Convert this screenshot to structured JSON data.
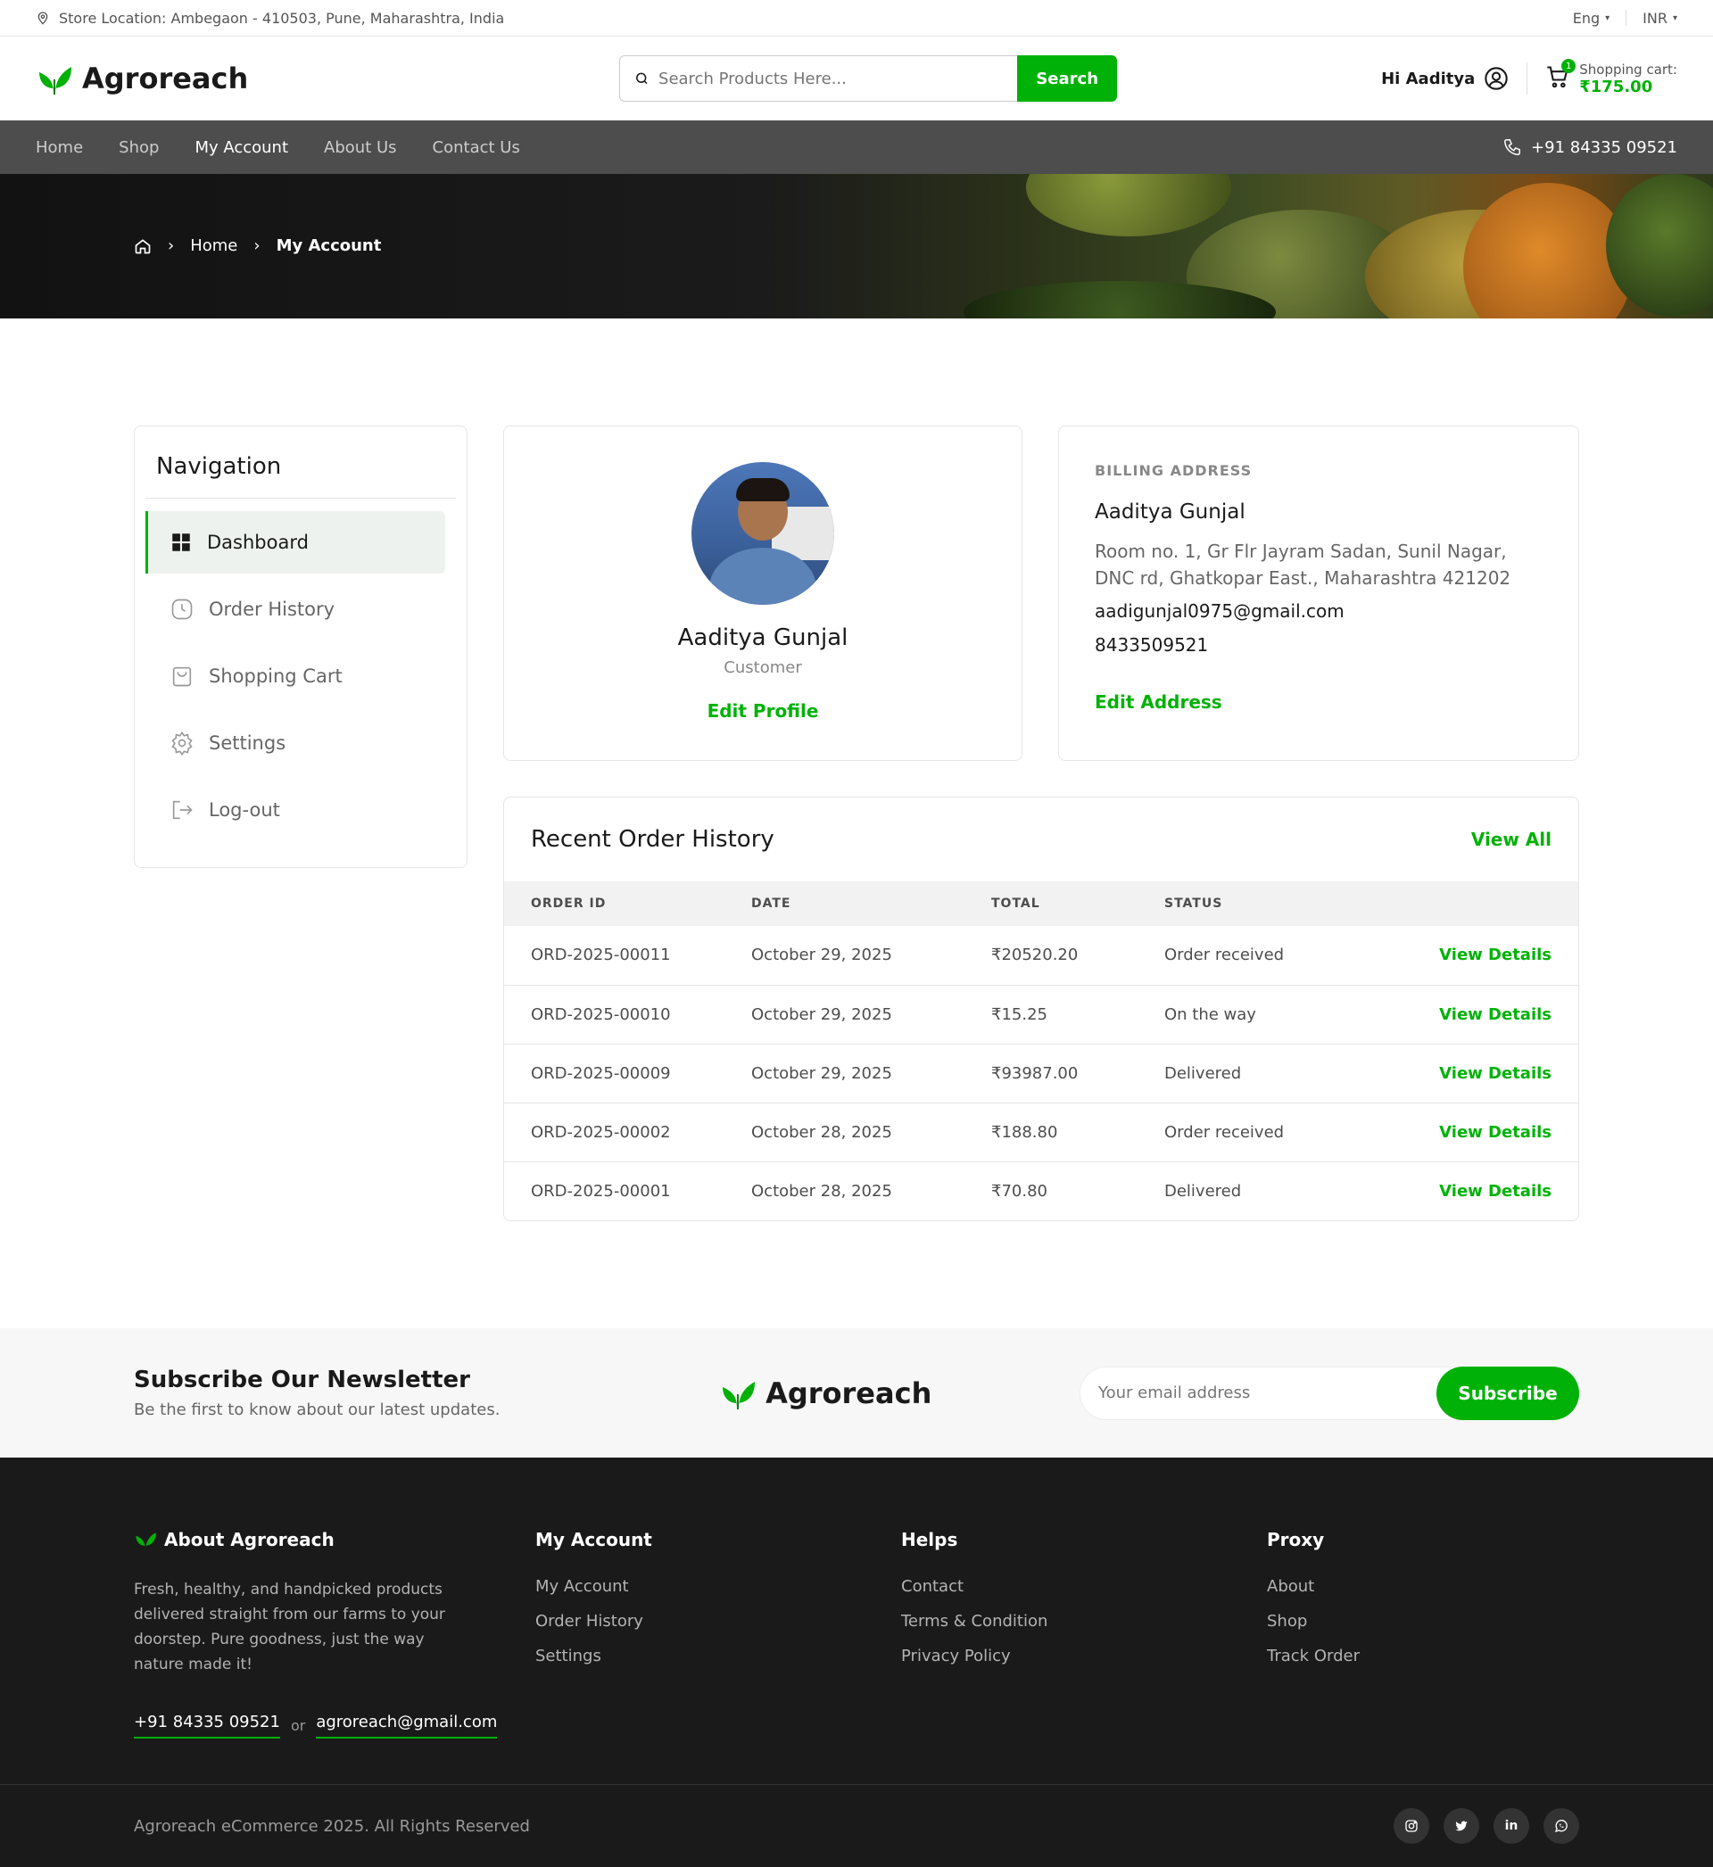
{
  "topbar": {
    "location": "Store Location: Ambegaon - 410503, Pune, Maharashtra, India",
    "language": "Eng",
    "currency": "INR"
  },
  "header": {
    "brand": "Agroreach",
    "search_placeholder": "Search Products Here...",
    "search_button": "Search",
    "greeting": "Hi Aaditya",
    "cart_label": "Shopping cart:",
    "cart_amount": "₹175.00",
    "cart_count": "1"
  },
  "nav": {
    "items": [
      "Home",
      "Shop",
      "My Account",
      "About Us",
      "Contact Us"
    ],
    "active": "My Account",
    "phone": "+91 84335 09521"
  },
  "breadcrumb": {
    "home": "Home",
    "current": "My Account"
  },
  "sidebar": {
    "title": "Navigation",
    "items": [
      {
        "label": "Dashboard",
        "icon": "dashboard-icon"
      },
      {
        "label": "Order History",
        "icon": "clock-icon"
      },
      {
        "label": "Shopping Cart",
        "icon": "bag-icon"
      },
      {
        "label": "Settings",
        "icon": "gear-icon"
      },
      {
        "label": "Log-out",
        "icon": "logout-icon"
      }
    ]
  },
  "profile": {
    "name": "Aaditya Gunjal",
    "role": "Customer",
    "edit_label": "Edit Profile"
  },
  "billing": {
    "label": "BILLING ADDRESS",
    "name": "Aaditya Gunjal",
    "address": "Room no. 1, Gr Flr Jayram Sadan, Sunil Nagar, DNC rd, Ghatkopar East., Maharashtra 421202",
    "email": "aadigunjal0975@gmail.com",
    "phone": "8433509521",
    "edit_label": "Edit Address"
  },
  "orders": {
    "title": "Recent Order History",
    "view_all": "View All",
    "columns": [
      "ORDER ID",
      "DATE",
      "TOTAL",
      "STATUS"
    ],
    "action_label": "View Details",
    "rows": [
      {
        "id": "ORD-2025-00011",
        "date": "October 29, 2025",
        "total": "₹20520.20",
        "status": "Order received"
      },
      {
        "id": "ORD-2025-00010",
        "date": "October 29, 2025",
        "total": "₹15.25",
        "status": "On the way"
      },
      {
        "id": "ORD-2025-00009",
        "date": "October 29, 2025",
        "total": "₹93987.00",
        "status": "Delivered"
      },
      {
        "id": "ORD-2025-00002",
        "date": "October 28, 2025",
        "total": "₹188.80",
        "status": "Order received"
      },
      {
        "id": "ORD-2025-00001",
        "date": "October 28, 2025",
        "total": "₹70.80",
        "status": "Delivered"
      }
    ]
  },
  "newsletter": {
    "title": "Subscribe Our Newsletter",
    "subtitle": "Be the first to know about our latest updates.",
    "brand": "Agroreach",
    "placeholder": "Your email address",
    "button": "Subscribe"
  },
  "footer": {
    "about_title": "About Agroreach",
    "about_text": "Fresh, healthy, and handpicked products delivered straight from our farms to your doorstep. Pure goodness, just the way nature made it!",
    "phone": "+91 84335 09521",
    "or": "or",
    "email": "agroreach@gmail.com",
    "columns": [
      {
        "title": "My Account",
        "links": [
          "My Account",
          "Order History",
          "Settings"
        ]
      },
      {
        "title": "Helps",
        "links": [
          "Contact",
          "Terms & Condition",
          "Privacy Policy"
        ]
      },
      {
        "title": "Proxy",
        "links": [
          "About",
          "Shop",
          "Track Order"
        ]
      }
    ],
    "copyright": "Agroreach eCommerce 2025. All Rights Reserved",
    "social": [
      "instagram-icon",
      "twitter-icon",
      "linkedin-icon",
      "whatsapp-icon"
    ]
  },
  "colors": {
    "accent": "#00b207",
    "nav_bg": "#4d4d4d",
    "footer_bg": "#1a1a1a"
  }
}
